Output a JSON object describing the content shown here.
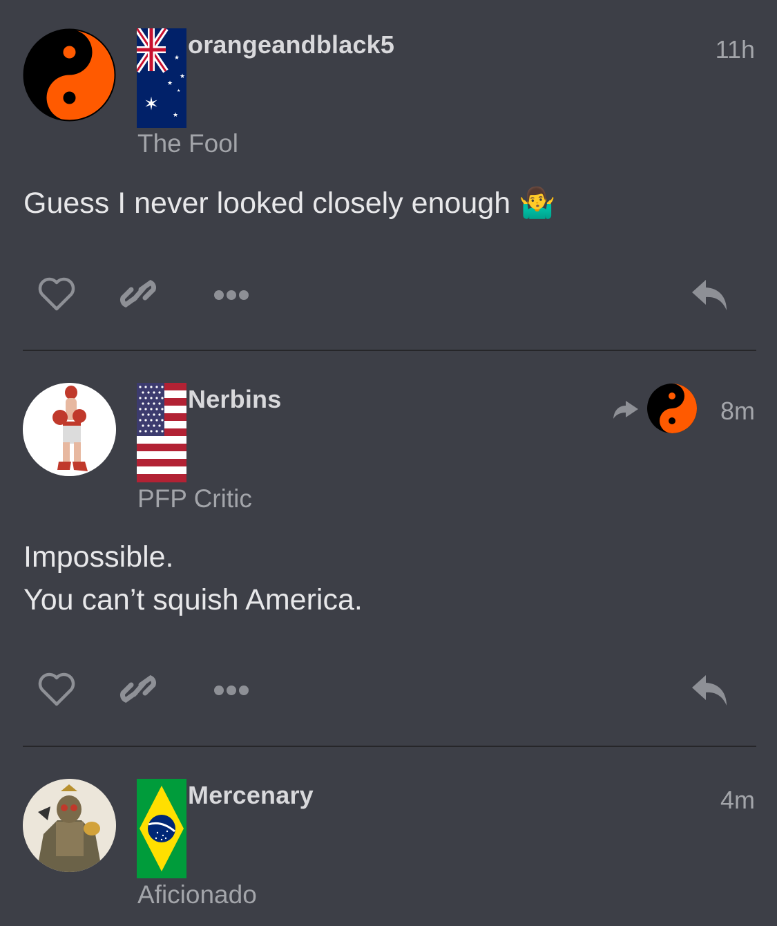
{
  "posts": [
    {
      "username": "orangeandblack5",
      "user_title": "The Fool",
      "time": "11h",
      "body_lines": [
        "Guess I never looked closely enough 🤷‍♂️"
      ],
      "flag": "australia-flag",
      "avatar": "yin-yang-orange-avatar"
    },
    {
      "username": "Nerbins",
      "user_title": "PFP Critic",
      "time": "8m",
      "body_lines": [
        "Impossible.",
        "You can’t squish America."
      ],
      "flag": "usa-flag",
      "avatar": "boxer-avatar",
      "reply_to_avatar": "yin-yang-orange-avatar"
    },
    {
      "username": "Mercenary",
      "user_title": "Aficionado",
      "time": "4m",
      "flag": "brazil-flag",
      "avatar": "soldier-character-avatar"
    }
  ],
  "actions": [
    "like-icon",
    "link-icon",
    "more-icon",
    "reply-icon"
  ],
  "colors": {
    "background": "#3d3f47",
    "divider": "#262629",
    "muted": "#a3a5aa",
    "icon": "#8e9096",
    "orange": "#ff5a00"
  }
}
